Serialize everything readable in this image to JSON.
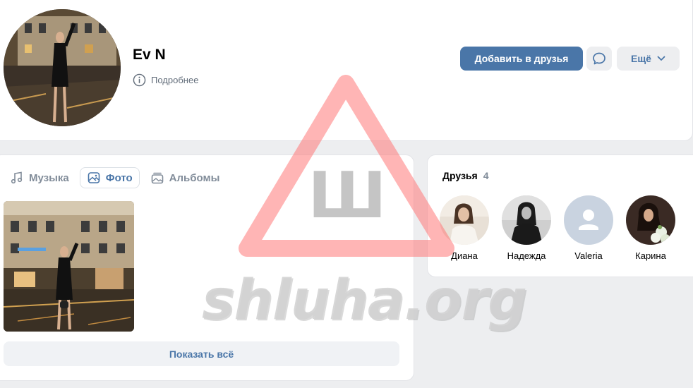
{
  "profile": {
    "name": "Ev N",
    "details_label": "Подробнее",
    "add_friend_label": "Добавить в друзья",
    "more_label": "Ещё"
  },
  "media": {
    "tabs": [
      {
        "label": "Музыка",
        "icon": "music-note-icon",
        "active": false
      },
      {
        "label": "Фото",
        "icon": "image-icon",
        "active": true
      },
      {
        "label": "Альбомы",
        "icon": "albums-icon",
        "active": false
      }
    ],
    "show_all_label": "Показать всё"
  },
  "friends": {
    "title": "Друзья",
    "count": "4",
    "items": [
      {
        "name": "Диана",
        "avatar": "photo"
      },
      {
        "name": "Надежда",
        "avatar": "photo"
      },
      {
        "name": "Valeria",
        "avatar": "placeholder"
      },
      {
        "name": "Карина",
        "avatar": "photo"
      }
    ]
  },
  "watermark": {
    "sign_letter": "Ш",
    "text": "shluha.org"
  },
  "colors": {
    "accent": "#4a76a8",
    "background": "#edeef0",
    "secondary_text": "#818c99",
    "watermark_red": "#ff8a8a"
  }
}
